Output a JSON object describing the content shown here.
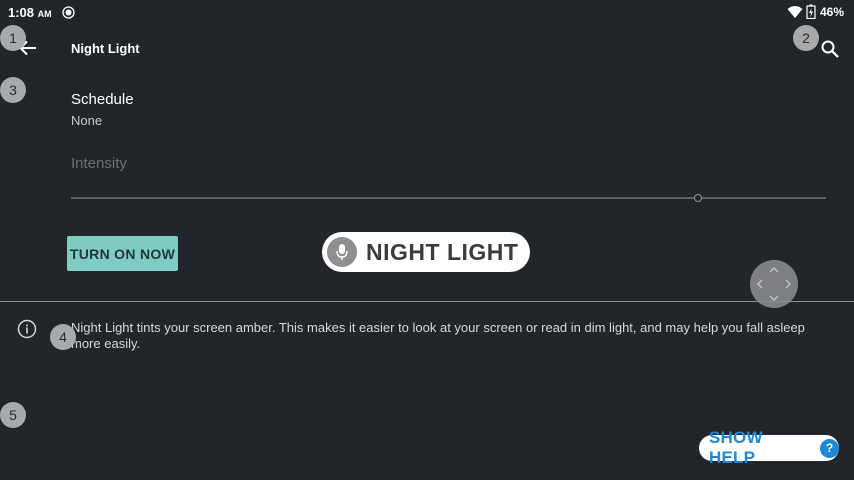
{
  "status_bar": {
    "time": "1:08",
    "ampm": "AM",
    "battery": "46%"
  },
  "toolbar": {
    "title": "Night Light"
  },
  "schedule": {
    "title": "Schedule",
    "value": "None"
  },
  "intensity": {
    "label": "Intensity",
    "level": 0.83
  },
  "turn_on_button": {
    "label": "TURN ON NOW"
  },
  "voice_chip": {
    "label": "NIGHT LIGHT"
  },
  "info": {
    "text": "Night Light tints your screen amber. This makes it easier to look at your screen or read in dim light, and may help you fall asleep more easily."
  },
  "help_chip": {
    "label": "SHOW HELP",
    "icon_text": "?"
  },
  "badges": [
    "1",
    "2",
    "3",
    "4",
    "5"
  ],
  "colors": {
    "background": "#22262b",
    "accent_teal": "#80cbc4",
    "help_blue": "#1e88d4"
  },
  "icons": [
    "location-dot-icon",
    "wifi-icon",
    "battery-charging-icon",
    "back-arrow-icon",
    "search-icon",
    "mic-icon",
    "drag-arrows-icon",
    "info-icon"
  ]
}
